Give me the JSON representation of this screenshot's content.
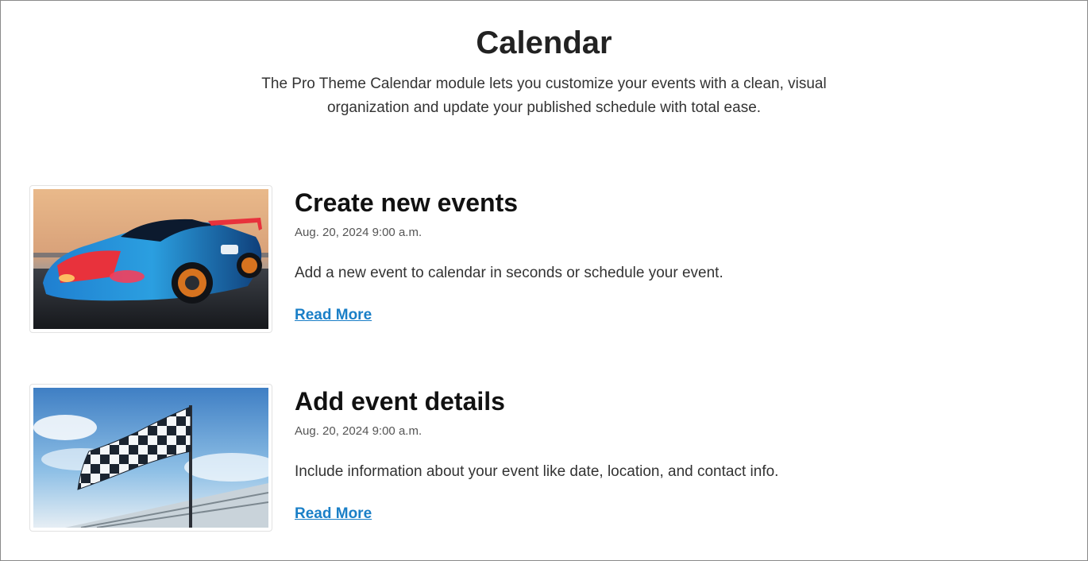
{
  "header": {
    "title": "Calendar",
    "intro": "The Pro Theme Calendar module lets you customize your events with a clean, visual organization and update your published schedule with total ease."
  },
  "colors": {
    "link": "#1a7fc7",
    "title": "#222222",
    "date": "#555555"
  },
  "events": [
    {
      "image": "race-car-image",
      "title": "Create new events",
      "date": "Aug. 20, 2024 9:00 a.m.",
      "description": "Add a new event to calendar in seconds or schedule your event.",
      "link": "Read More"
    },
    {
      "image": "checkered-flag-image",
      "title": "Add event details",
      "date": "Aug. 20, 2024 9:00 a.m.",
      "description": "Include information about your event like date, location, and contact info.",
      "link": "Read More"
    }
  ]
}
